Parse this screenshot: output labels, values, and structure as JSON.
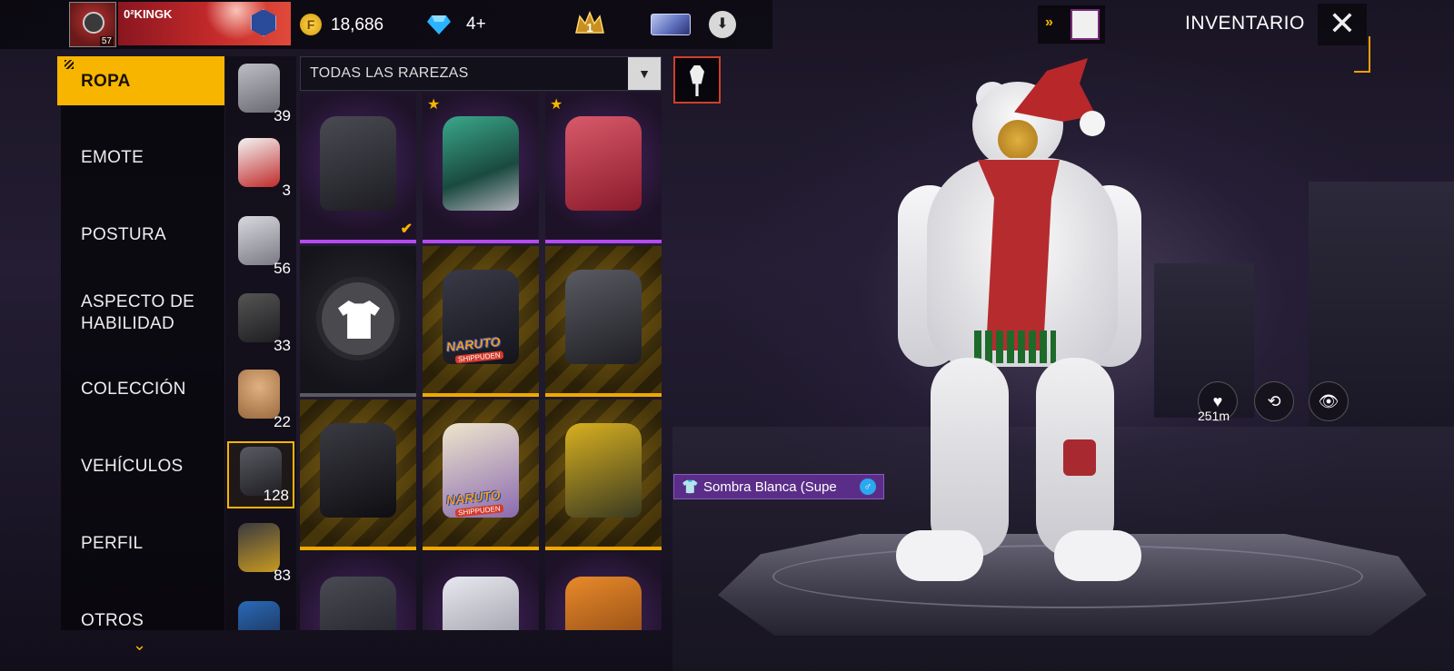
{
  "player": {
    "name": "0²KINGK",
    "level": "57"
  },
  "currency": {
    "gold": "18,686",
    "diamonds": "4+"
  },
  "rank_badge": "1",
  "header": {
    "title": "INVENTARIO"
  },
  "sidebar": {
    "items": [
      {
        "label": "ROPA",
        "active": true
      },
      {
        "label": "EMOTE"
      },
      {
        "label": "POSTURA"
      },
      {
        "label": "ASPECTO DE\nHABILIDAD"
      },
      {
        "label": "COLECCIÓN"
      },
      {
        "label": "VEHÍCULOS"
      },
      {
        "label": "PERFIL"
      },
      {
        "label": "OTROS"
      }
    ]
  },
  "categories": [
    {
      "icon": "pants-icon",
      "count": "39"
    },
    {
      "icon": "full-outfit-icon",
      "count": "3"
    },
    {
      "icon": "hair-icon",
      "count": "56"
    },
    {
      "icon": "mask-icon",
      "count": "33"
    },
    {
      "icon": "head-icon",
      "count": "22"
    },
    {
      "icon": "top-icon",
      "count": "128",
      "selected": true
    },
    {
      "icon": "bottom-icon",
      "count": "83"
    },
    {
      "icon": "shoes-icon",
      "count": ""
    }
  ],
  "filter": {
    "label": "TODAS LAS RAREZAS"
  },
  "items": [
    {
      "rarity": "purple",
      "starred": false,
      "equipped": true,
      "color": "#2c2c32"
    },
    {
      "rarity": "purple",
      "starred": true,
      "equipped": false,
      "color": "#2a7a6a"
    },
    {
      "rarity": "purple",
      "starred": true,
      "equipped": false,
      "color": "#a8283a"
    },
    {
      "rarity": "dark",
      "empty": true
    },
    {
      "rarity": "gold",
      "color": "#2a2a36",
      "brand": "NARUTO",
      "brand_sub": "SHIPPUDEN"
    },
    {
      "rarity": "gold",
      "color": "#3a3a40"
    },
    {
      "rarity": "gold",
      "color": "#1e1e24"
    },
    {
      "rarity": "gold",
      "color": "#d8d0b8",
      "brand": "NARUTO",
      "brand_sub": "SHIPPUDEN"
    },
    {
      "rarity": "gold",
      "color": "#a88a18"
    },
    {
      "rarity": "purple",
      "color": "#3a3a44"
    },
    {
      "rarity": "purple",
      "color": "#c8c8d0"
    },
    {
      "rarity": "purple",
      "color": "#d0701a"
    }
  ],
  "selected_item": {
    "name": "Sombra Blanca (Supe",
    "gender": "♂"
  },
  "actions": [
    {
      "name": "distance-icon",
      "label": "251m"
    },
    {
      "name": "rotate-phone-icon"
    },
    {
      "name": "view-character-icon"
    }
  ]
}
